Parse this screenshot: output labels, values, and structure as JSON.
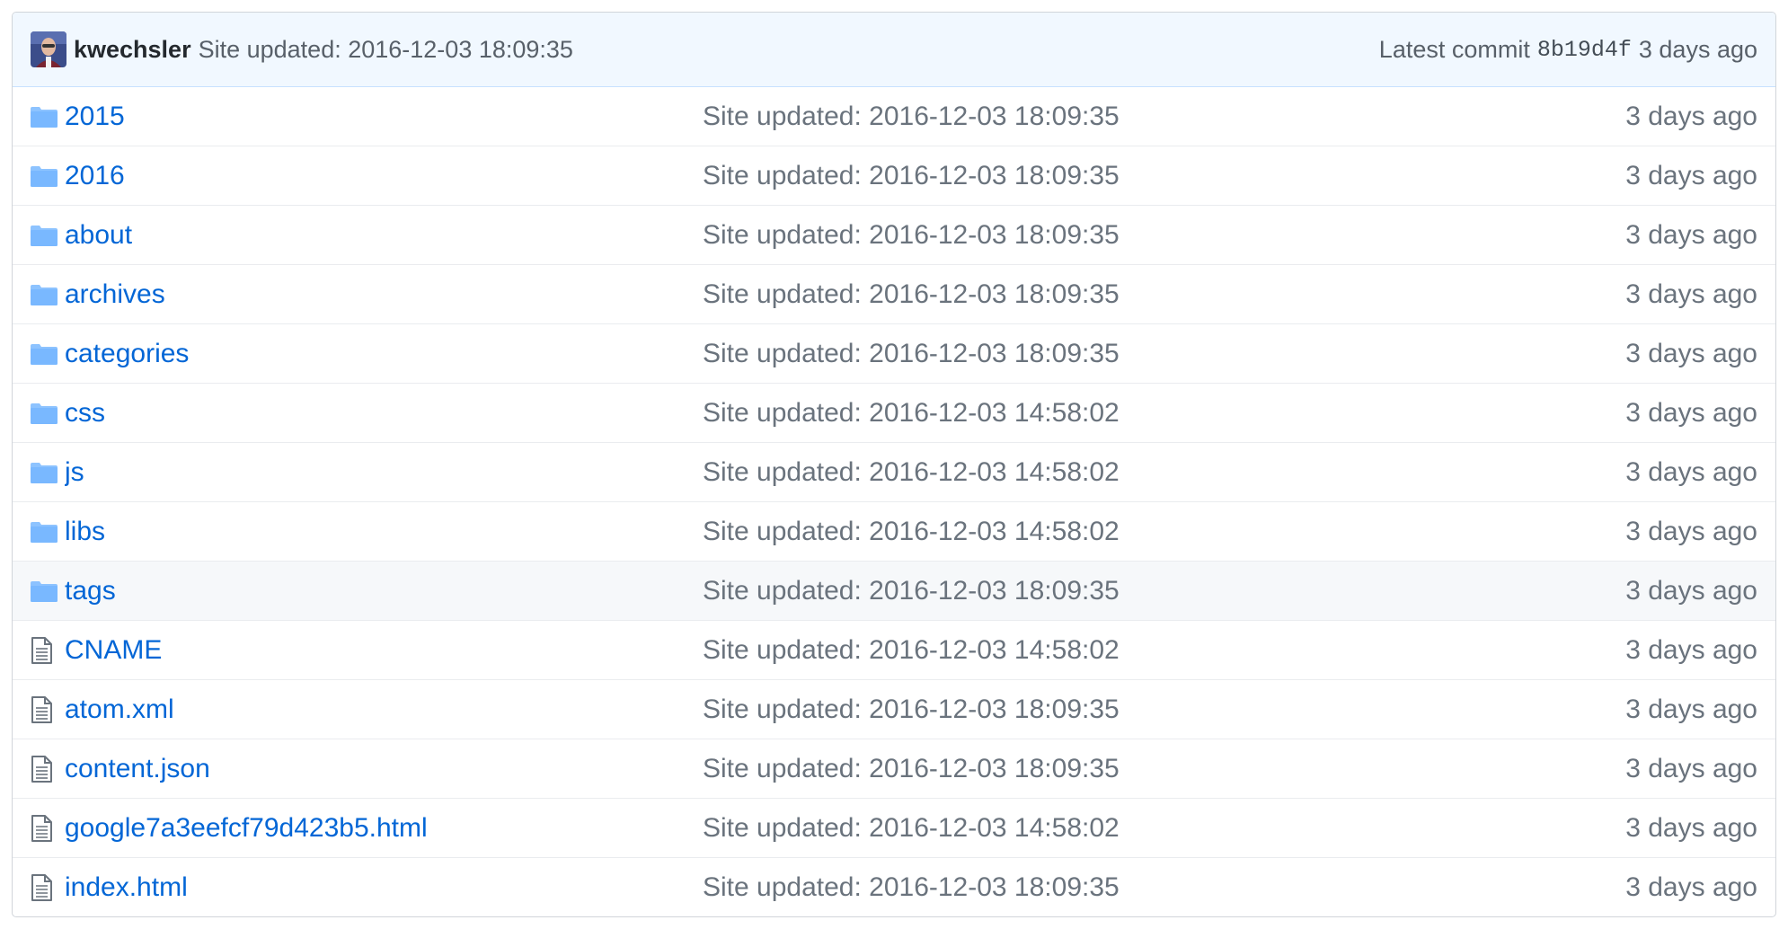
{
  "commit": {
    "author": "kwechsler",
    "message": "Site updated: 2016-12-03 18:09:35",
    "latest_label": "Latest commit",
    "sha": "8b19d4f",
    "age": "3 days ago"
  },
  "colors": {
    "link": "#0366d6",
    "folder_icon": "#79b8ff",
    "file_icon": "#6a737d",
    "commit_bar_bg": "#f1f8ff"
  },
  "files": [
    {
      "type": "folder",
      "icon": "folder-icon",
      "name": "2015",
      "message": "Site updated: 2016-12-03 18:09:35",
      "age": "3 days ago"
    },
    {
      "type": "folder",
      "icon": "folder-icon",
      "name": "2016",
      "message": "Site updated: 2016-12-03 18:09:35",
      "age": "3 days ago"
    },
    {
      "type": "folder",
      "icon": "folder-icon",
      "name": "about",
      "message": "Site updated: 2016-12-03 18:09:35",
      "age": "3 days ago"
    },
    {
      "type": "folder",
      "icon": "folder-icon",
      "name": "archives",
      "message": "Site updated: 2016-12-03 18:09:35",
      "age": "3 days ago"
    },
    {
      "type": "folder",
      "icon": "folder-icon",
      "name": "categories",
      "message": "Site updated: 2016-12-03 18:09:35",
      "age": "3 days ago"
    },
    {
      "type": "folder",
      "icon": "folder-icon",
      "name": "css",
      "message": "Site updated: 2016-12-03 14:58:02",
      "age": "3 days ago"
    },
    {
      "type": "folder",
      "icon": "folder-icon",
      "name": "js",
      "message": "Site updated: 2016-12-03 14:58:02",
      "age": "3 days ago"
    },
    {
      "type": "folder",
      "icon": "folder-icon",
      "name": "libs",
      "message": "Site updated: 2016-12-03 14:58:02",
      "age": "3 days ago"
    },
    {
      "type": "folder",
      "icon": "folder-icon",
      "name": "tags",
      "message": "Site updated: 2016-12-03 18:09:35",
      "age": "3 days ago",
      "hovered": true
    },
    {
      "type": "file",
      "icon": "file-icon",
      "name": "CNAME",
      "message": "Site updated: 2016-12-03 14:58:02",
      "age": "3 days ago"
    },
    {
      "type": "file",
      "icon": "file-icon",
      "name": "atom.xml",
      "message": "Site updated: 2016-12-03 18:09:35",
      "age": "3 days ago"
    },
    {
      "type": "file",
      "icon": "file-icon",
      "name": "content.json",
      "message": "Site updated: 2016-12-03 18:09:35",
      "age": "3 days ago"
    },
    {
      "type": "file",
      "icon": "file-icon",
      "name": "google7a3eefcf79d423b5.html",
      "message": "Site updated: 2016-12-03 14:58:02",
      "age": "3 days ago"
    },
    {
      "type": "file",
      "icon": "file-icon",
      "name": "index.html",
      "message": "Site updated: 2016-12-03 18:09:35",
      "age": "3 days ago"
    }
  ]
}
